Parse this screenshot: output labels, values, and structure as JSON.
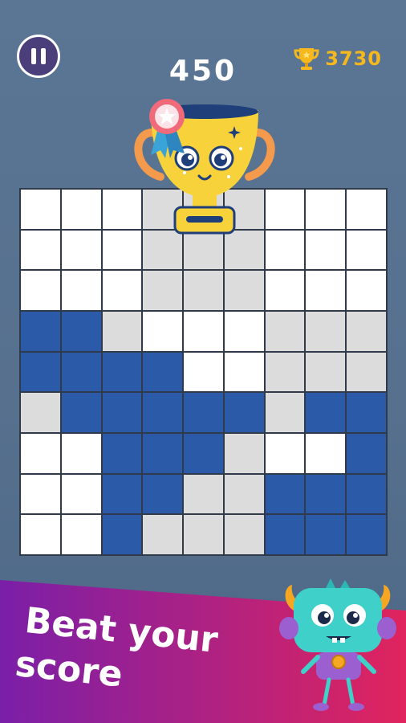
{
  "header": {
    "score": "450",
    "best_score": "3730",
    "pause_icon": "pause-icon",
    "best_icon": "trophy-icon"
  },
  "board": {
    "rows": 9,
    "cols": 9,
    "cells": [
      [
        "w",
        "w",
        "w",
        "g",
        "g",
        "g",
        "w",
        "w",
        "w"
      ],
      [
        "w",
        "w",
        "w",
        "g",
        "g",
        "g",
        "w",
        "w",
        "w"
      ],
      [
        "w",
        "w",
        "w",
        "g",
        "g",
        "g",
        "w",
        "w",
        "w"
      ],
      [
        "b",
        "b",
        "g",
        "w",
        "w",
        "w",
        "g",
        "g",
        "g"
      ],
      [
        "b",
        "b",
        "b",
        "b",
        "w",
        "w",
        "g",
        "g",
        "g"
      ],
      [
        "g",
        "b",
        "b",
        "b",
        "b",
        "b",
        "g",
        "b",
        "b"
      ],
      [
        "w",
        "w",
        "b",
        "b",
        "b",
        "g",
        "w",
        "w",
        "b"
      ],
      [
        "w",
        "w",
        "b",
        "b",
        "g",
        "g",
        "b",
        "b",
        "b"
      ],
      [
        "w",
        "w",
        "b",
        "g",
        "g",
        "g",
        "b",
        "b",
        "b"
      ]
    ]
  },
  "colors": {
    "filled": "#2b5aa8",
    "empty_light": "#ffffff",
    "empty_shade": "#dcdcdc",
    "background": "#56708e",
    "gold": "#f6b81d",
    "banner_start": "#7a1fa8",
    "banner_end": "#e0245e"
  },
  "promo": {
    "line1": "Beat your",
    "line2": "score",
    "mascot_trophy": "trophy-mascot-icon",
    "mascot_monster": "monster-mascot-icon"
  }
}
